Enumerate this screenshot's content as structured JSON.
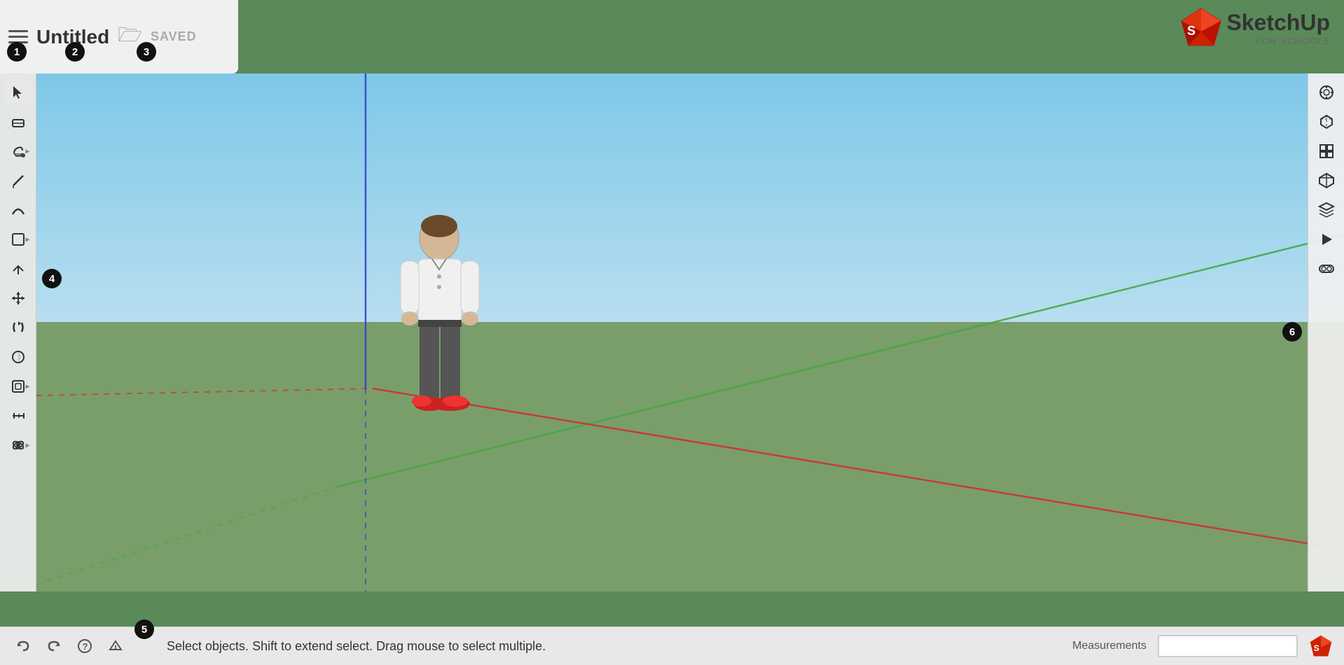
{
  "header": {
    "menu_label": "Menu",
    "title": "Untitled",
    "save_status": "SAVED"
  },
  "logo": {
    "name": "SketchUp",
    "tagline": "FOR SCHOOLS"
  },
  "status_bar": {
    "status_text": "Select objects. Shift to extend select. Drag mouse to select multiple.",
    "measurements_label": "Measurements",
    "measurements_value": ""
  },
  "badges": [
    {
      "id": "1",
      "label": "1"
    },
    {
      "id": "2",
      "label": "2"
    },
    {
      "id": "3",
      "label": "3"
    },
    {
      "id": "4",
      "label": "4"
    },
    {
      "id": "5",
      "label": "5"
    },
    {
      "id": "6",
      "label": "6"
    }
  ],
  "left_toolbar": {
    "tools": [
      {
        "name": "select",
        "icon": "↖",
        "has_arrow": false
      },
      {
        "name": "eraser",
        "icon": "◻",
        "has_arrow": false
      },
      {
        "name": "paint",
        "icon": "⊕",
        "has_arrow": true
      },
      {
        "name": "pencil",
        "icon": "✏",
        "has_arrow": false
      },
      {
        "name": "arc",
        "icon": "⌒",
        "has_arrow": false
      },
      {
        "name": "shapes",
        "icon": "⬡",
        "has_arrow": true
      },
      {
        "name": "push-pull",
        "icon": "⊞",
        "has_arrow": false
      },
      {
        "name": "move",
        "icon": "✛",
        "has_arrow": false
      },
      {
        "name": "rotate",
        "icon": "↻",
        "has_arrow": false
      },
      {
        "name": "follow-me",
        "icon": "⌘",
        "has_arrow": false
      },
      {
        "name": "offset",
        "icon": "◎",
        "has_arrow": true
      },
      {
        "name": "tape",
        "icon": "✂",
        "has_arrow": false
      },
      {
        "name": "orbit",
        "icon": "❋",
        "has_arrow": true
      }
    ]
  },
  "right_toolbar": {
    "tools": [
      {
        "name": "scene-settings",
        "icon": "⊙"
      },
      {
        "name": "styles",
        "icon": "🎓"
      },
      {
        "name": "components",
        "icon": "⬡"
      },
      {
        "name": "view-iso",
        "icon": "⬡"
      },
      {
        "name": "layers",
        "icon": "☰"
      },
      {
        "name": "animation",
        "icon": "▶"
      },
      {
        "name": "vr",
        "icon": "○○"
      }
    ]
  }
}
